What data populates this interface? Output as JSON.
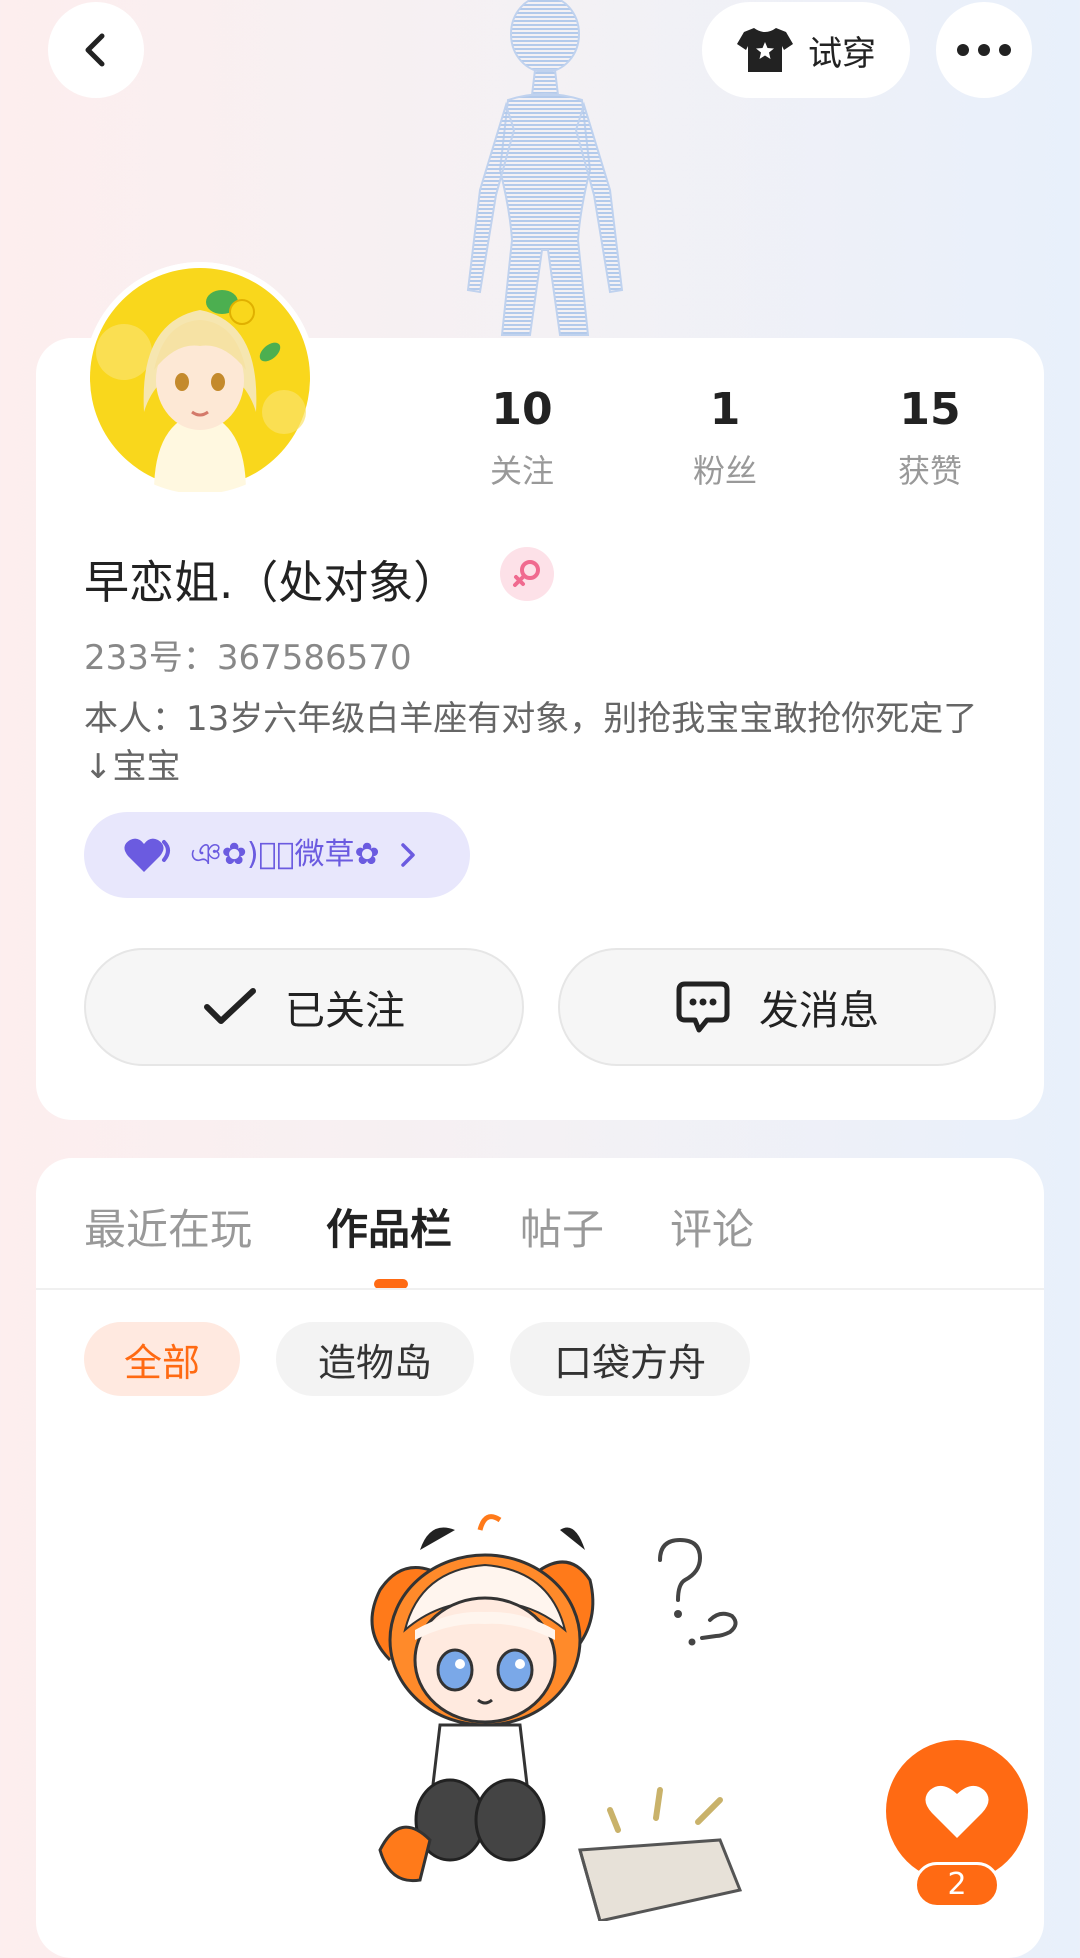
{
  "header": {
    "back_icon": "chevron-left-icon",
    "tryon_label": "试穿",
    "tryon_icon": "shirt-icon",
    "more_icon": "more-horizontal-icon"
  },
  "profile": {
    "stats": [
      {
        "value": "10",
        "label": "关注"
      },
      {
        "value": "1",
        "label": "粉丝"
      },
      {
        "value": "15",
        "label": "获赞"
      }
    ],
    "nickname": "早恋姐.（处对象）",
    "gender_icon": "female-icon",
    "uid": "233号：367586570",
    "bio": "本人：13岁六年级白羊座有对象，别抢我宝宝敢抢你死定了↓宝宝",
    "group": {
      "icon": "heart-icon",
      "label": "ঞ✿)ृ⃝微草✿",
      "chevron_icon": "chevron-right-icon"
    },
    "buttons": {
      "followed_label": "已关注",
      "message_label": "发消息"
    }
  },
  "tabs": [
    {
      "label": "最近在玩",
      "active": false
    },
    {
      "label": "作品栏",
      "active": true
    },
    {
      "label": "帖子",
      "active": false
    },
    {
      "label": "评论",
      "active": false
    }
  ],
  "filters": [
    {
      "label": "全部",
      "active": true
    },
    {
      "label": "造物岛",
      "active": false
    },
    {
      "label": "口袋方舟",
      "active": false
    }
  ],
  "fab": {
    "icon": "heart-icon",
    "count": "2"
  },
  "colors": {
    "accent": "#ff6a13",
    "group_bg": "#e8e7fc",
    "group_text": "#6b5be0"
  }
}
